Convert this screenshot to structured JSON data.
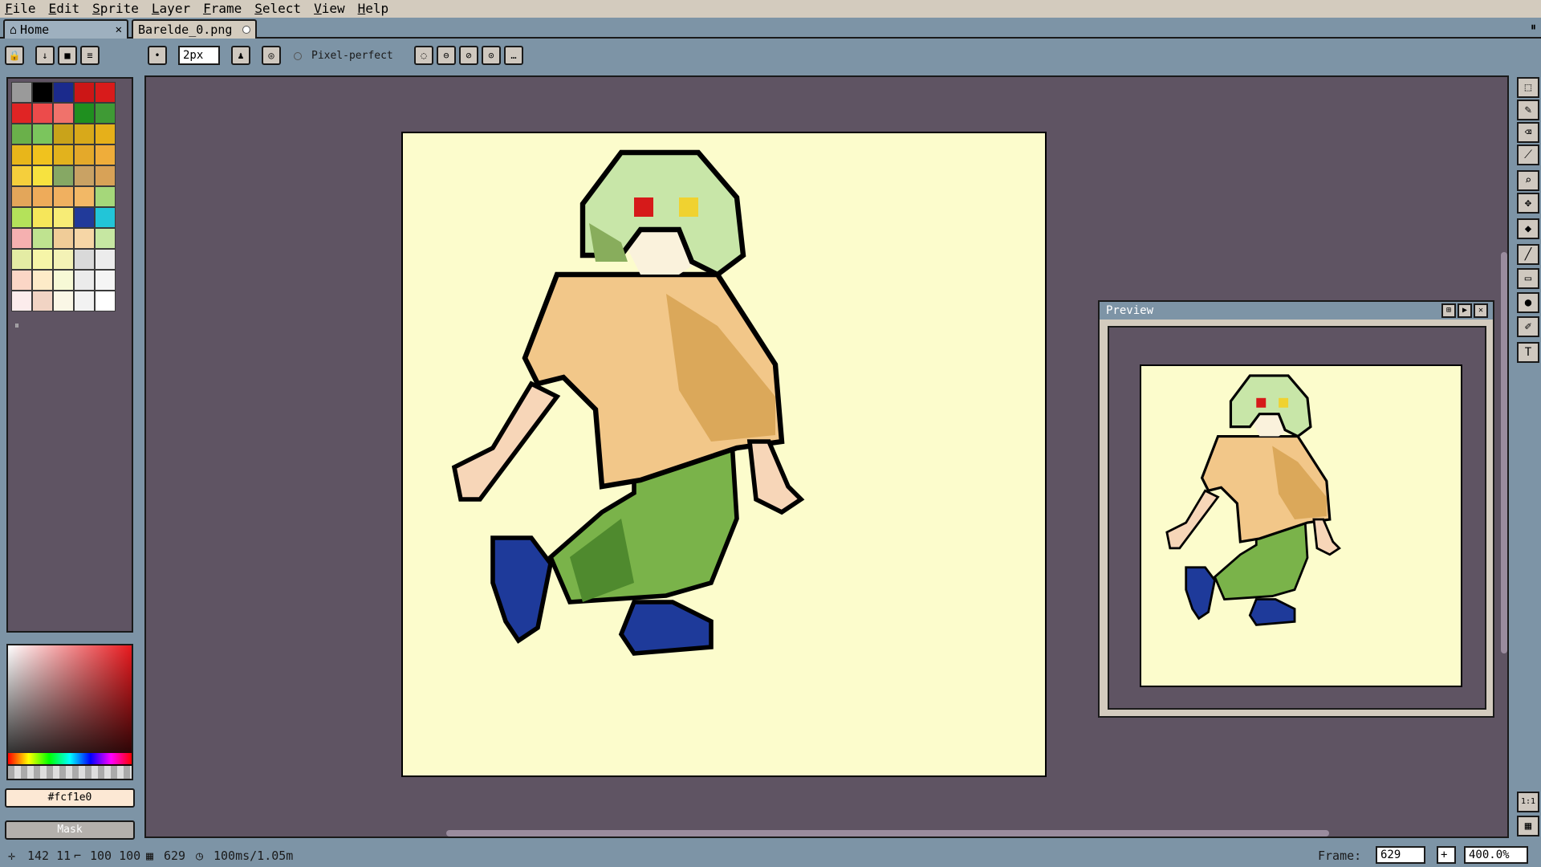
{
  "menu": [
    "File",
    "Edit",
    "Sprite",
    "Layer",
    "Frame",
    "Select",
    "View",
    "Help"
  ],
  "tabs": {
    "home": "Home",
    "file": "Barelde_0.png"
  },
  "toolbar": {
    "brush_size": "2px",
    "pixel_perfect": "Pixel-perfect"
  },
  "palette": {
    "colors": [
      "#9a9a9a",
      "#000000",
      "#1b2a8c",
      "#cc1616",
      "#d81b1b",
      "#e02424",
      "#ec4b4b",
      "#f0726b",
      "#1f8f1f",
      "#3f9a35",
      "#6ab04a",
      "#7bc55d",
      "#c9a31a",
      "#d8a91a",
      "#e6b01a",
      "#e8b61a",
      "#f0c21e",
      "#e2b21d",
      "#e4a92a",
      "#efad3a",
      "#f5cf3c",
      "#f7e23f",
      "#86a864",
      "#c9a264",
      "#d8a257",
      "#e3a65a",
      "#eeab5a",
      "#f0b060",
      "#f2b866",
      "#a5d77a",
      "#b4e25a",
      "#f6e65a",
      "#f7ec76",
      "#213a9a",
      "#22c5d8",
      "#f5b0b0",
      "#bfe390",
      "#f0cc98",
      "#f6d6a6",
      "#c6e7a2",
      "#e4eca4",
      "#f6f5a8",
      "#f4f2b6",
      "#d9d9d9",
      "#ececec",
      "#fbd6c6",
      "#fdebc8",
      "#f7f9d6",
      "#ebebeb",
      "#f5f5f5",
      "#fcecec",
      "#f1d4c4",
      "#faf7e6",
      "#f2f2f2",
      "#ffffff"
    ]
  },
  "colorbar": {
    "hex": "#fcf1e0",
    "mask": "Mask"
  },
  "preview": {
    "title": "Preview"
  },
  "status": {
    "pos": "142 11",
    "size": "100 100",
    "frame_num": "629",
    "duration": "100ms/1.05m",
    "frame_label": "Frame:",
    "frame_value": "629",
    "zoom": "400.0%"
  },
  "sprite_colors": {
    "background": "#fcfccc",
    "hair": "#c8e6a8",
    "shirt": "#f2c789",
    "shirt_shadow": "#dba85a",
    "pants": "#7ab34a",
    "pants_shadow": "#4f8a2e",
    "skin": "#f7d6b8",
    "shoe": "#1e3a9a"
  }
}
